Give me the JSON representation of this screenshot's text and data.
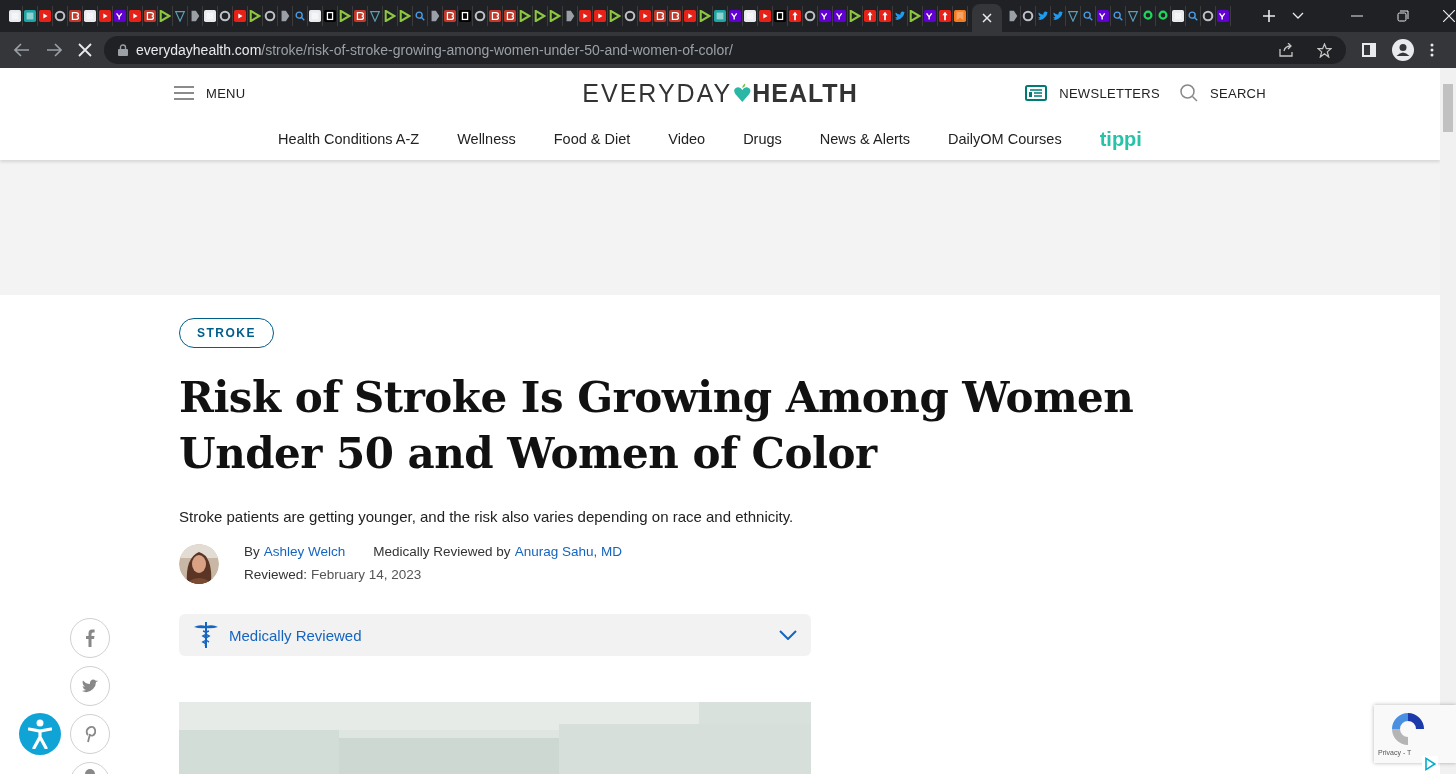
{
  "browser": {
    "tabs": [
      {
        "kind": "misc",
        "selected": false
      },
      {
        "kind": "teal",
        "selected": false
      },
      {
        "kind": "yt",
        "selected": false
      },
      {
        "kind": "cycle",
        "selected": false
      },
      {
        "kind": "red",
        "selected": false
      },
      {
        "kind": "misc",
        "selected": false
      },
      {
        "kind": "yt",
        "selected": false
      },
      {
        "kind": "yahoo",
        "selected": false
      },
      {
        "kind": "yt",
        "selected": false
      },
      {
        "kind": "red",
        "selected": false
      },
      {
        "kind": "play",
        "selected": false
      },
      {
        "kind": "shield",
        "selected": false
      },
      {
        "kind": "arrow",
        "selected": false
      },
      {
        "kind": "misc",
        "selected": false
      },
      {
        "kind": "cycle",
        "selected": false
      },
      {
        "kind": "yt",
        "selected": false
      },
      {
        "kind": "play",
        "selected": false
      },
      {
        "kind": "cycle",
        "selected": false
      },
      {
        "kind": "arrow",
        "selected": false
      },
      {
        "kind": "search",
        "selected": false
      },
      {
        "kind": "misc",
        "selected": false
      },
      {
        "kind": "dark",
        "selected": false
      },
      {
        "kind": "play",
        "selected": false
      },
      {
        "kind": "red",
        "selected": false
      },
      {
        "kind": "shield",
        "selected": false
      },
      {
        "kind": "play",
        "selected": false
      },
      {
        "kind": "play",
        "selected": false
      },
      {
        "kind": "search",
        "selected": false
      },
      {
        "kind": "arrow",
        "selected": false
      },
      {
        "kind": "red",
        "selected": false
      },
      {
        "kind": "dark",
        "selected": false
      },
      {
        "kind": "cycle",
        "selected": false
      },
      {
        "kind": "red",
        "selected": false
      },
      {
        "kind": "red",
        "selected": false
      },
      {
        "kind": "play",
        "selected": false
      },
      {
        "kind": "play",
        "selected": false
      },
      {
        "kind": "play",
        "selected": false
      },
      {
        "kind": "arrow",
        "selected": false
      },
      {
        "kind": "yt",
        "selected": false
      },
      {
        "kind": "yt",
        "selected": false
      },
      {
        "kind": "play",
        "selected": false
      },
      {
        "kind": "cycle",
        "selected": false
      },
      {
        "kind": "yt",
        "selected": false
      },
      {
        "kind": "red",
        "selected": false
      },
      {
        "kind": "red",
        "selected": false
      },
      {
        "kind": "yt",
        "selected": false
      },
      {
        "kind": "play",
        "selected": false
      },
      {
        "kind": "teal",
        "selected": false
      },
      {
        "kind": "yahoo",
        "selected": false
      },
      {
        "kind": "misc",
        "selected": false
      },
      {
        "kind": "yt",
        "selected": false
      },
      {
        "kind": "dark",
        "selected": false
      },
      {
        "kind": "flag",
        "selected": false
      },
      {
        "kind": "cycle",
        "selected": false
      },
      {
        "kind": "yahoo",
        "selected": false
      },
      {
        "kind": "yahoo",
        "selected": false
      },
      {
        "kind": "play",
        "selected": false
      },
      {
        "kind": "flag",
        "selected": false
      },
      {
        "kind": "flag",
        "selected": false
      },
      {
        "kind": "twitter",
        "selected": false
      },
      {
        "kind": "play",
        "selected": false
      },
      {
        "kind": "yahoo",
        "selected": false
      },
      {
        "kind": "flag",
        "selected": false
      },
      {
        "kind": "bookmark",
        "selected": false
      },
      {
        "kind": "blank",
        "selected": true
      },
      {
        "kind": "arrow",
        "selected": false
      },
      {
        "kind": "cycle",
        "selected": false
      },
      {
        "kind": "twitter",
        "selected": false
      },
      {
        "kind": "twitter",
        "selected": false
      },
      {
        "kind": "shield",
        "selected": false
      },
      {
        "kind": "search",
        "selected": false
      },
      {
        "kind": "yahoo",
        "selected": false
      },
      {
        "kind": "search",
        "selected": false
      },
      {
        "kind": "shield",
        "selected": false
      },
      {
        "kind": "gg",
        "selected": false
      },
      {
        "kind": "gg",
        "selected": false
      },
      {
        "kind": "misc",
        "selected": false
      },
      {
        "kind": "search",
        "selected": false
      },
      {
        "kind": "cycle",
        "selected": false
      },
      {
        "kind": "yahoo",
        "selected": false
      }
    ],
    "url": {
      "host": "everydayhealth.com",
      "path": "/stroke/risk-of-stroke-growing-among-women-under-50-and-women-of-color/"
    }
  },
  "header": {
    "menu": "MENU",
    "logo": {
      "left": "EVERYDAY",
      "right": "HEALTH"
    },
    "newsletters": "NEWSLETTERS",
    "search": "SEARCH",
    "nav": [
      {
        "label": "Health Conditions A-Z",
        "kind": "link"
      },
      {
        "label": "Wellness",
        "kind": "link"
      },
      {
        "label": "Food & Diet",
        "kind": "link"
      },
      {
        "label": "Video",
        "kind": "link"
      },
      {
        "label": "Drugs",
        "kind": "link"
      },
      {
        "label": "News & Alerts",
        "kind": "link"
      },
      {
        "label": "DailyOM Courses",
        "kind": "link"
      },
      {
        "label": "tippi",
        "kind": "brand"
      }
    ]
  },
  "article": {
    "tag": "STROKE",
    "title": "Risk of Stroke Is Growing Among Women Under 50 and Women of Color",
    "subtitle": "Stroke patients are getting younger, and the risk also varies depending on race and ethnicity.",
    "byline": {
      "by": "By",
      "author": "Ashley Welch",
      "reviewed_by": "Medically Reviewed by",
      "reviewer": "Anurag Sahu, MD",
      "reviewed_label": "Reviewed:",
      "reviewed_date": "February 14, 2023"
    },
    "medically_reviewed": {
      "label": "Medically Reviewed",
      "expanded": false
    }
  },
  "share": [
    {
      "kind": "facebook"
    },
    {
      "kind": "twitter"
    },
    {
      "kind": "pinterest"
    },
    {
      "kind": "more"
    }
  ],
  "recaptcha": {
    "text": "Privacy - T"
  }
}
